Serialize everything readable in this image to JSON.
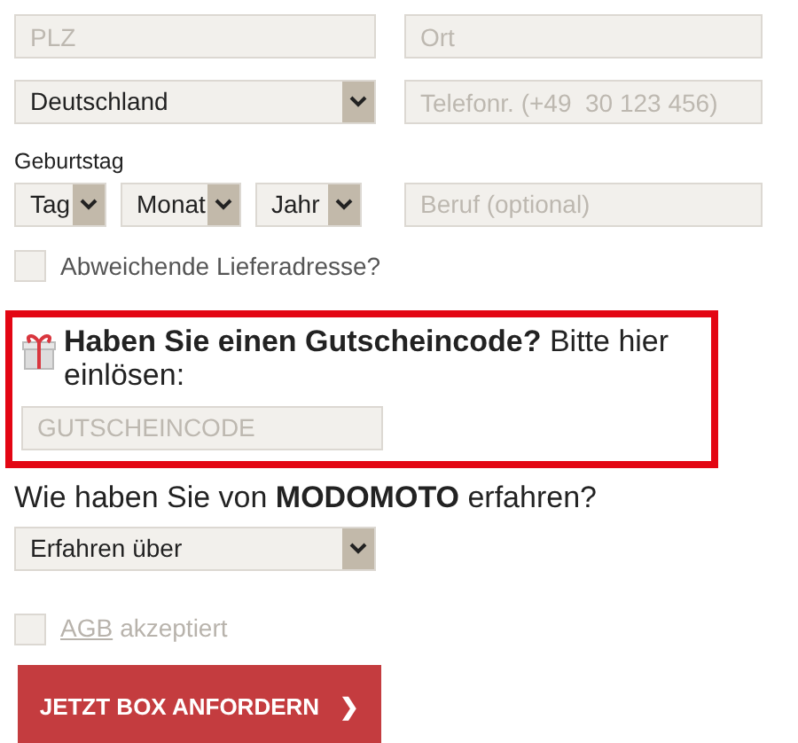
{
  "rows": [
    {
      "left": {
        "kind": "input",
        "placeholder": "PLZ"
      },
      "right": {
        "kind": "input",
        "placeholder": "Ort"
      }
    },
    {
      "left": {
        "kind": "select",
        "value": "Deutschland"
      },
      "right": {
        "kind": "input",
        "placeholder": "Telefonr. (+49  30 123 456)"
      }
    }
  ],
  "birthday": {
    "label": "Geburtstag",
    "selects": [
      {
        "value": "Tag"
      },
      {
        "value": "Monat"
      },
      {
        "value": "Jahr"
      }
    ],
    "job": {
      "placeholder": "Beruf (optional)"
    }
  },
  "alt_address": {
    "label": "Abweichende Lieferadresse?",
    "checked": false
  },
  "voucher": {
    "heading": "**Haben Sie einen Gutscheincode?** Bitte hier einlösen:",
    "placeholder": "GUTSCHEINCODE",
    "highlighted": true
  },
  "referral": {
    "question": "Wie haben Sie von **MODOMOTO** erfahren?",
    "value": "Erfahren über"
  },
  "terms": {
    "link": "AGB",
    "label": "akzeptiert",
    "checked": false
  },
  "submit": {
    "label": "JETZT BOX ANFORDERN",
    "arrow": "❯"
  }
}
